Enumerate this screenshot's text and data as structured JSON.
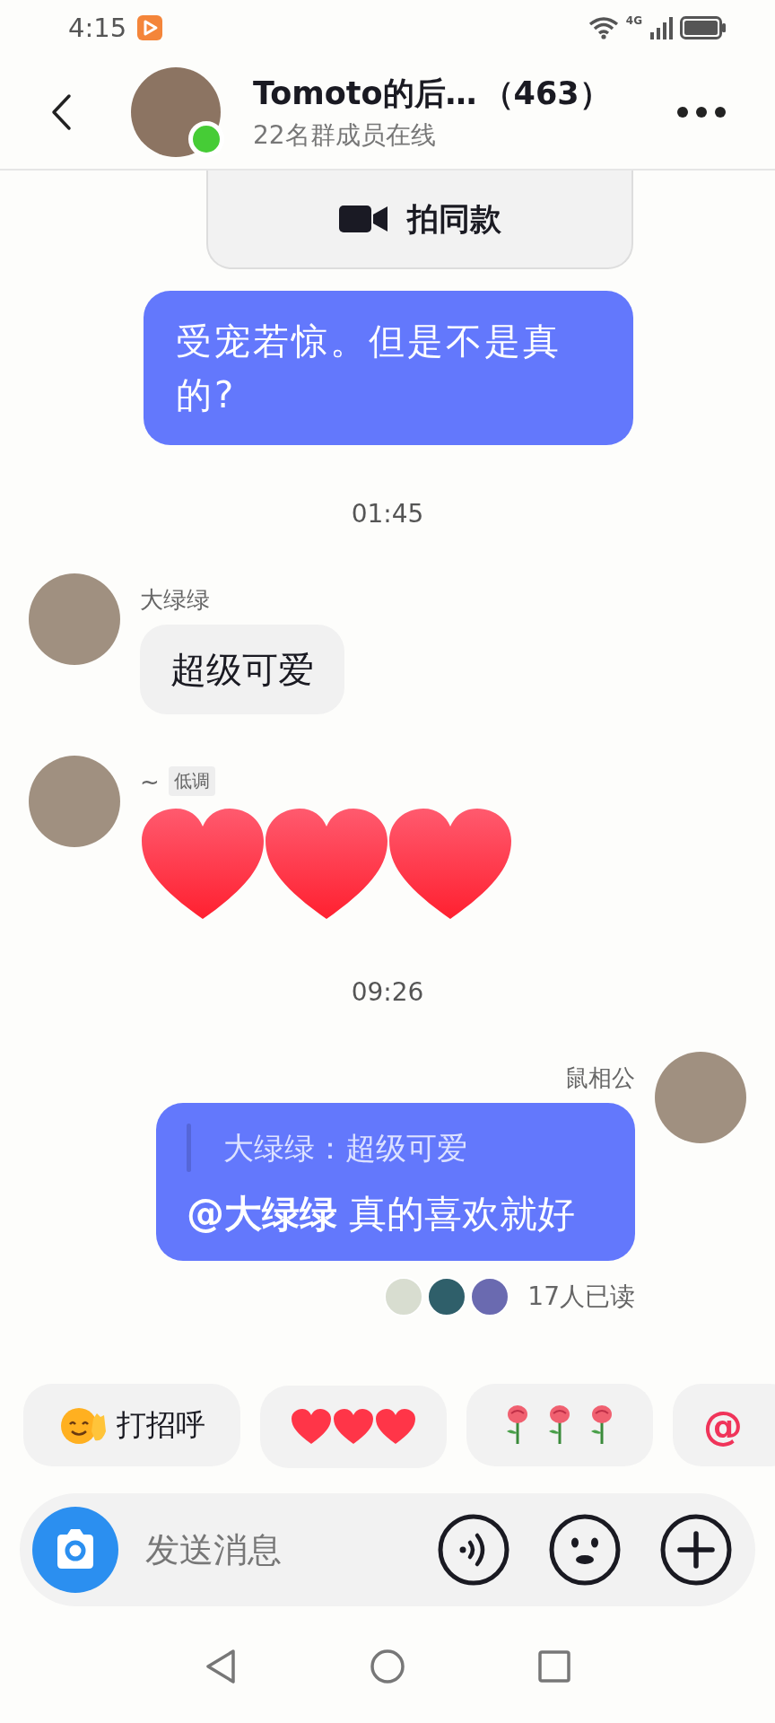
{
  "status_bar": {
    "time": "4:15",
    "network": "4G"
  },
  "header": {
    "title": "Tomoto的后…",
    "count": "（463）",
    "subtitle": "22名群成员在线",
    "online": true
  },
  "messages": [
    {
      "kind": "action_card",
      "label": "拍同款"
    },
    {
      "kind": "text",
      "outgoing": true,
      "text": "受宠若惊。但是不是真的?"
    },
    {
      "kind": "time",
      "text": "01:45"
    },
    {
      "kind": "text",
      "outgoing": false,
      "sender": "大绿绿",
      "text": "超级可爱"
    },
    {
      "kind": "hearts",
      "outgoing": false,
      "sender": "~",
      "tag": "低调"
    },
    {
      "kind": "time",
      "text": "09:26"
    },
    {
      "kind": "reply",
      "outgoing": true,
      "sender": "鼠相公",
      "quote": "大绿绿：超级可爱",
      "text": "**@大绿绿** 真的喜欢就好",
      "read": "17人已读",
      "readers": [
        {
          "color": "#d8ddd0"
        },
        {
          "color": "#2f5f6a"
        },
        {
          "color": "#6a6ab0"
        }
      ]
    }
  ],
  "quick_replies": [
    {
      "kind": "wave",
      "label": "打招呼"
    },
    {
      "kind": "hearts"
    },
    {
      "kind": "roses"
    },
    {
      "kind": "mention",
      "label": "@"
    }
  ],
  "input": {
    "placeholder": "发送消息"
  }
}
